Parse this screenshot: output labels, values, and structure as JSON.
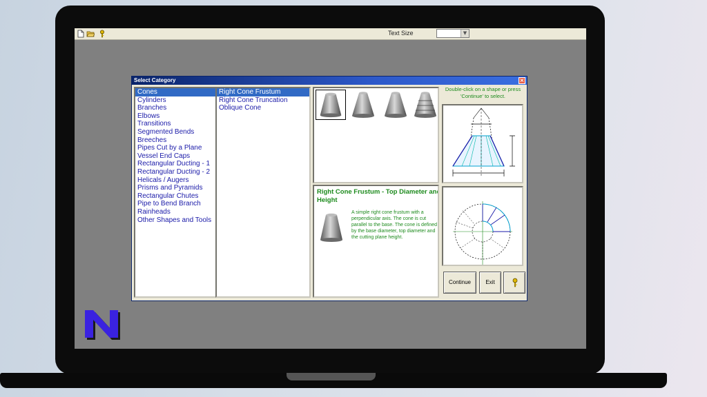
{
  "toolbar": {
    "icons": [
      "new-file-icon",
      "open-folder-icon",
      "key-help-icon"
    ],
    "text_size_label": "Text Size",
    "text_size_value": ""
  },
  "dialog": {
    "title": "Select Category",
    "categories": [
      {
        "label": "Cones",
        "selected": true
      },
      {
        "label": "Cylinders"
      },
      {
        "label": "Branches"
      },
      {
        "label": "Elbows"
      },
      {
        "label": "Transitions"
      },
      {
        "label": "Segmented Bends"
      },
      {
        "label": "Breeches"
      },
      {
        "label": "Pipes Cut by a Plane"
      },
      {
        "label": "Vessel End Caps"
      },
      {
        "label": "Rectangular Ducting - 1"
      },
      {
        "label": "Rectangular Ducting - 2"
      },
      {
        "label": "Helicals / Augers"
      },
      {
        "label": "Prisms and Pyramids"
      },
      {
        "label": "Rectangular Chutes"
      },
      {
        "label": "Pipe to Bend Branch"
      },
      {
        "label": "Rainheads"
      },
      {
        "label": "Other Shapes and Tools"
      }
    ],
    "subcategories": [
      {
        "label": "Right Cone Frustum",
        "selected": true
      },
      {
        "label": "Right Cone Truncation"
      },
      {
        "label": "Oblique Cone"
      }
    ],
    "hint": "Double-click on a shape or press 'Continue' to select.",
    "description": {
      "title": "Right Cone Frustum - Top Diameter and Height",
      "body": "A simple right cone frustum with a perpendicular axis. The cone is cut parallel to the base. The cone is defined by the base diameter, top diameter and the cutting plane height."
    },
    "buttons": {
      "continue": "Continue",
      "exit": "Exit"
    }
  },
  "colors": {
    "desktop": "#808080",
    "titlebar": "#0a246a",
    "list_text": "#1a1aa8",
    "description_text": "#1c8a1c",
    "logo": "#3a22e0"
  }
}
